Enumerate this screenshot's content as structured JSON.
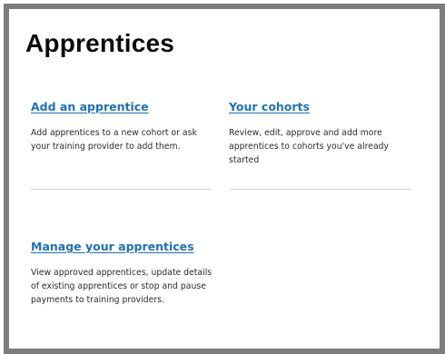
{
  "page": {
    "title": "Apprentices"
  },
  "cards": [
    {
      "link": "Add an apprentice",
      "description": "Add apprentices to a new cohort or ask your training provider to add them."
    },
    {
      "link": "Your cohorts",
      "description": "Review, edit, approve and add more apprentices to cohorts you've already started"
    },
    {
      "link": "Manage your apprentices",
      "description": "View approved apprentices, update details of existing apprentices or stop and pause payments to training providers."
    }
  ],
  "colors": {
    "link": "#1d70b8",
    "text": "#0b0c0c",
    "frame": "#7d7d7d",
    "divider": "#cfd3d6"
  }
}
